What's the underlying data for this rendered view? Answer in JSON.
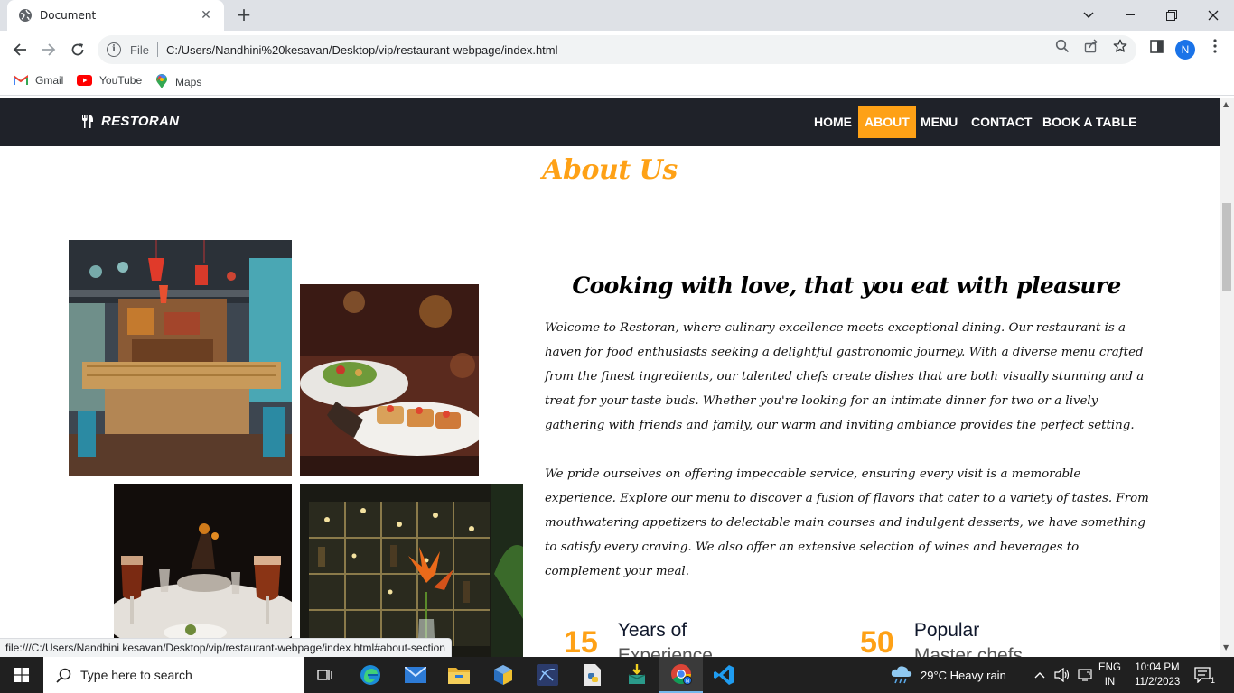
{
  "browser": {
    "tab_title": "Document",
    "address": {
      "scheme_label": "File",
      "url": "C:/Users/Nandhini%20kesavan/Desktop/vip/restaurant-webpage/index.html"
    },
    "profile_initial": "N",
    "bookmarks": [
      {
        "label": "Gmail",
        "icon": "gmail-icon"
      },
      {
        "label": "YouTube",
        "icon": "youtube-icon"
      },
      {
        "label": "Maps",
        "icon": "maps-icon"
      }
    ],
    "status_url": "file:///C:/Users/Nandhini kesavan/Desktop/vip/restaurant-webpage/index.html#about-section"
  },
  "site": {
    "brand": "RESTORAN",
    "nav": [
      {
        "label": "HOME",
        "active": false
      },
      {
        "label": "ABOUT",
        "active": true
      },
      {
        "label": "MENU",
        "active": false
      },
      {
        "label": "CONTACT",
        "active": false
      },
      {
        "label": "BOOK A TABLE",
        "active": false
      }
    ],
    "accent_color": "#fea116",
    "nav_bg_color": "#1f2229"
  },
  "about": {
    "title": "About Us",
    "heading": "Cooking with love, that you eat with pleasure",
    "paragraph_1": "Welcome to Restoran, where culinary excellence meets exceptional dining. Our restaurant is a haven for food enthusiasts seeking a delightful gastronomic journey. With a diverse menu crafted from the finest ingredients, our talented chefs create dishes that are both visually stunning and a treat for your taste buds. Whether you're looking for an intimate dinner for two or a lively gathering with friends and family, our warm and inviting ambiance provides the perfect setting.",
    "paragraph_2": "We pride ourselves on offering impeccable service, ensuring every visit is a memorable experience. Explore our menu to discover a fusion of flavors that cater to a variety of tastes. From mouthwatering appetizers to delectable main courses and indulgent desserts, we have something to satisfy every craving. We also offer an extensive selection of wines and beverages to complement your meal.",
    "stats": [
      {
        "number": "15",
        "line1": "Years of",
        "line2": "Experience"
      },
      {
        "number": "50",
        "line1": "Popular",
        "line2": "Master chefs"
      }
    ]
  },
  "taskbar": {
    "search_placeholder": "Type here to search",
    "weather": "29°C  Heavy rain",
    "lang_line1": "ENG",
    "lang_line2": "IN",
    "time": "10:04 PM",
    "date": "11/2/2023",
    "notification_count": "1"
  }
}
